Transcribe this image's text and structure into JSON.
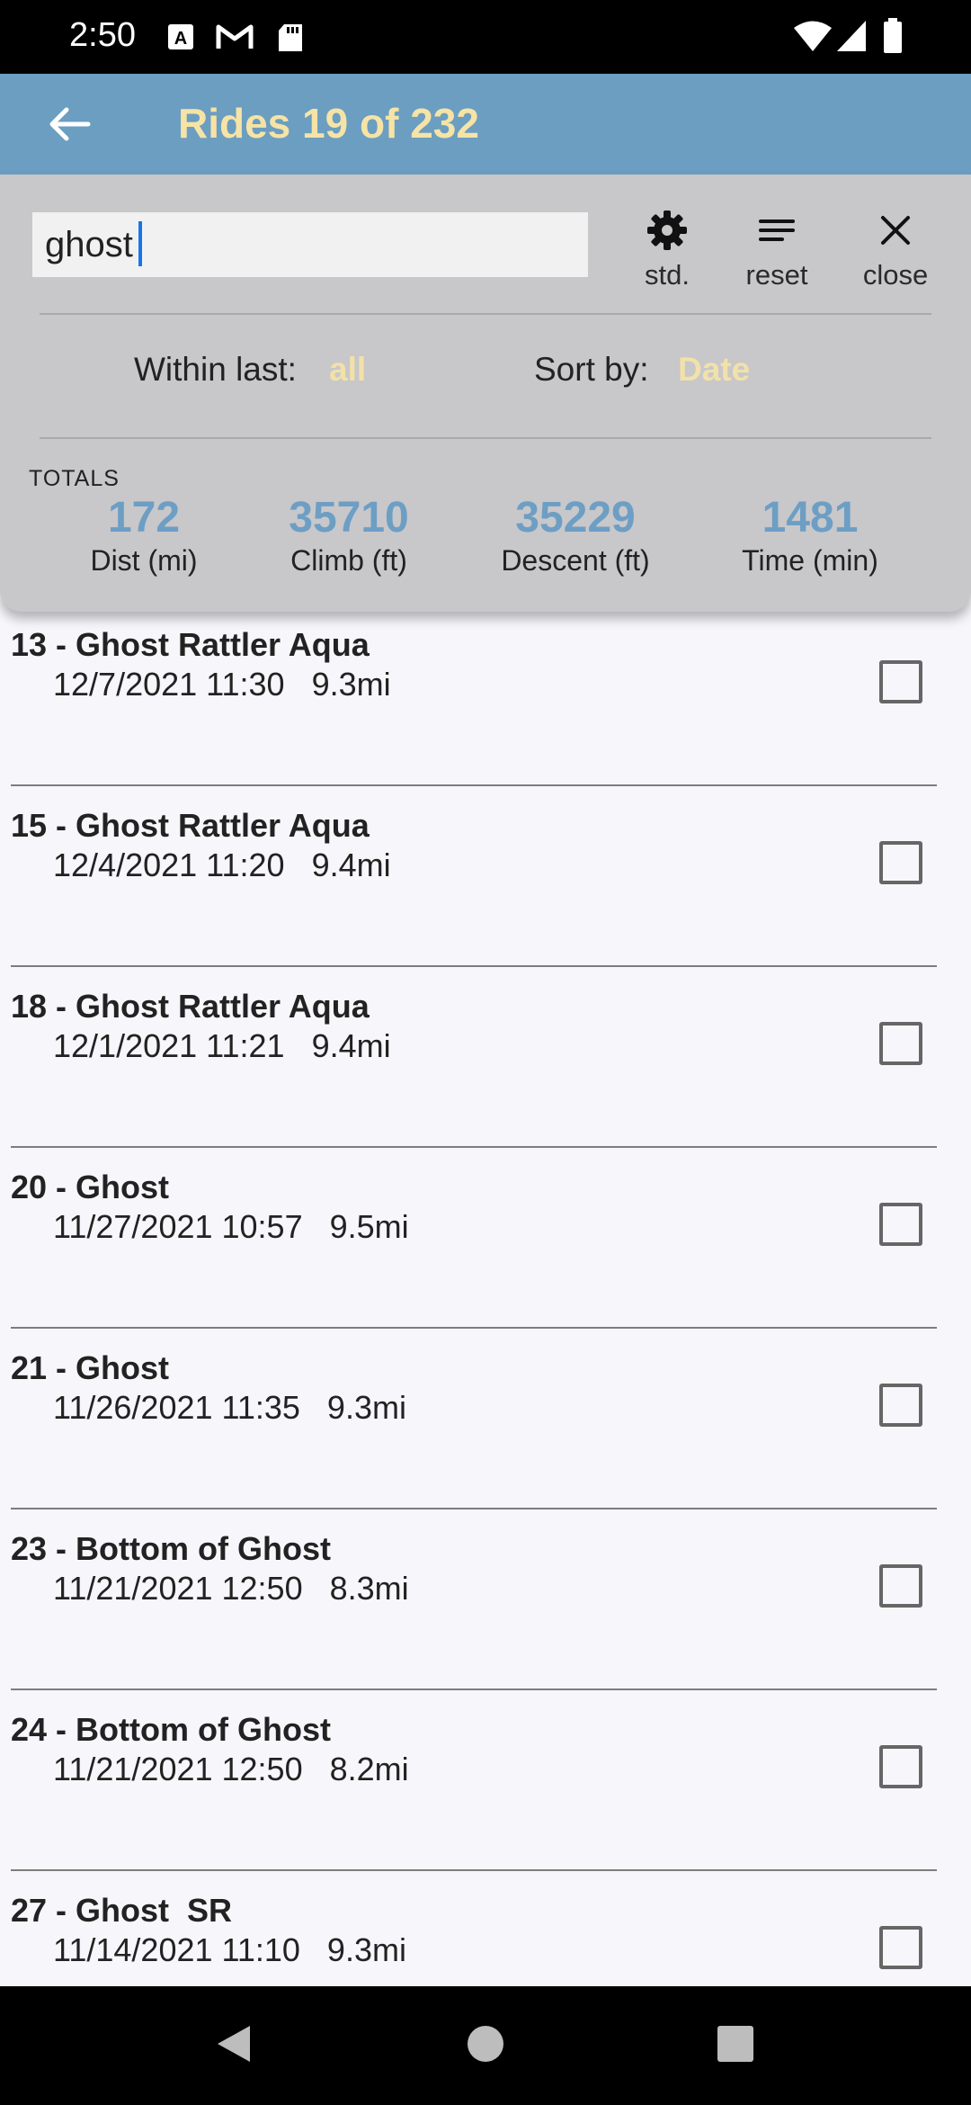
{
  "status_bar": {
    "time": "2:50",
    "icons": [
      "a-notification-icon",
      "gmail-icon",
      "sd-card-icon",
      "wifi-icon",
      "signal-icon",
      "battery-icon"
    ]
  },
  "app_bar": {
    "title": "Rides 19 of 232",
    "back_icon": "arrow-left-icon",
    "title_color": "#f6e3a6",
    "background": "#6b9ec1"
  },
  "search": {
    "value": "ghost",
    "placeholder": ""
  },
  "toolbar": {
    "std_label": "std.",
    "reset_label": "reset",
    "close_label": "close"
  },
  "filters": {
    "within_label": "Within last:",
    "within_value": "all",
    "sort_label": "Sort by:",
    "sort_value": "Date"
  },
  "totals": {
    "title": "TOTALS",
    "items": [
      {
        "value": "172",
        "label": "Dist (mi)"
      },
      {
        "value": "35710",
        "label": "Climb (ft)"
      },
      {
        "value": "35229",
        "label": "Descent (ft)"
      },
      {
        "value": "1481",
        "label": "Time (min)"
      }
    ]
  },
  "rides": [
    {
      "title": "13 - Ghost Rattler Aqua",
      "subtitle": "12/7/2021 11:30   9.3mi",
      "checked": false
    },
    {
      "title": "15 - Ghost Rattler Aqua",
      "subtitle": "12/4/2021 11:20   9.4mi",
      "checked": false
    },
    {
      "title": "18 - Ghost Rattler Aqua",
      "subtitle": "12/1/2021 11:21   9.4mi",
      "checked": false
    },
    {
      "title": "20 - Ghost",
      "subtitle": "11/27/2021 10:57   9.5mi",
      "checked": false
    },
    {
      "title": "21 - Ghost",
      "subtitle": "11/26/2021 11:35   9.3mi",
      "checked": false
    },
    {
      "title": "23 - Bottom of Ghost",
      "subtitle": "11/21/2021 12:50   8.3mi",
      "checked": false
    },
    {
      "title": "24 - Bottom of Ghost",
      "subtitle": "11/21/2021 12:50   8.2mi",
      "checked": false
    },
    {
      "title": "27 - Ghost  SR",
      "subtitle": "11/14/2021 11:10   9.3mi",
      "checked": false
    }
  ],
  "nav_bar": {
    "icons": [
      "back-triangle-icon",
      "home-circle-icon",
      "recents-square-icon"
    ]
  }
}
